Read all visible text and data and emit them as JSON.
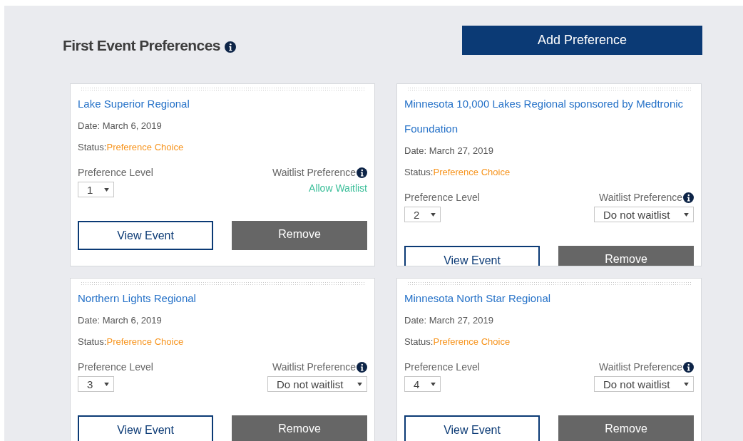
{
  "heading": "First Event Preferences",
  "add_button": "Add Preference",
  "cards": [
    {
      "title": "Lake Superior Regional",
      "date_label": "Date:",
      "date": "March 6, 2019",
      "status_label": "Status:",
      "status": "Preference Choice",
      "level_label": "Preference Level",
      "level_value": "1",
      "waitlist_label": "Waitlist Preference",
      "waitlist": {
        "kind": "text",
        "value": "Allow Waitlist"
      },
      "view_button": "View Event",
      "remove_button": "Remove"
    },
    {
      "title": "Minnesota 10,000 Lakes Regional sponsored by Medtronic Foundation",
      "date_label": "Date:",
      "date": "March 27, 2019",
      "status_label": "Status:",
      "status": "Preference Choice",
      "level_label": "Preference Level",
      "level_value": "2",
      "waitlist_label": "Waitlist Preference",
      "waitlist": {
        "kind": "select",
        "value": "Do not waitlist"
      },
      "view_button": "View Event",
      "remove_button": "Remove"
    },
    {
      "title": "Northern Lights Regional",
      "date_label": "Date:",
      "date": "March 6, 2019",
      "status_label": "Status:",
      "status": "Preference Choice",
      "level_label": "Preference Level",
      "level_value": "3",
      "waitlist_label": "Waitlist Preference",
      "waitlist": {
        "kind": "select",
        "value": "Do not waitlist"
      },
      "view_button": "View Event",
      "remove_button": "Remove"
    },
    {
      "title": "Minnesota North Star Regional",
      "date_label": "Date:",
      "date": "March 27, 2019",
      "status_label": "Status:",
      "status": "Preference Choice",
      "level_label": "Preference Level",
      "level_value": "4",
      "waitlist_label": "Waitlist Preference",
      "waitlist": {
        "kind": "select",
        "value": "Do not waitlist"
      },
      "view_button": "View Event",
      "remove_button": "Remove"
    }
  ]
}
